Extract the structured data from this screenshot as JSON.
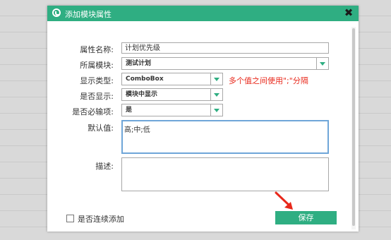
{
  "dialog": {
    "title": "添加模块属性",
    "close_label": "✖"
  },
  "form": {
    "name_label": "属性名称:",
    "name_value": "计划优先级",
    "module_label": "所属模块:",
    "module_value": "测试计划",
    "type_label": "显示类型:",
    "type_value": "ComboBox",
    "type_hint": "多个值之间使用\";\"分隔",
    "display_label": "是否显示:",
    "display_value": "模块中显示",
    "required_label": "是否必输项:",
    "required_value": "是",
    "default_label": "默认值:",
    "default_value": "高;中;低",
    "desc_label": "描述:",
    "desc_value": ""
  },
  "footer": {
    "continuous_add_label": "是否连续添加",
    "continuous_add_checked": false,
    "save_label": "保存"
  },
  "colors": {
    "accent": "#2fae82",
    "hint": "#e8281b",
    "annotation_arrow": "#e8281b"
  },
  "icons": {
    "title": "logo-swirl-icon",
    "close": "close-icon",
    "dropdown": "chevron-down-icon",
    "annotation": "red-arrow-icon"
  }
}
